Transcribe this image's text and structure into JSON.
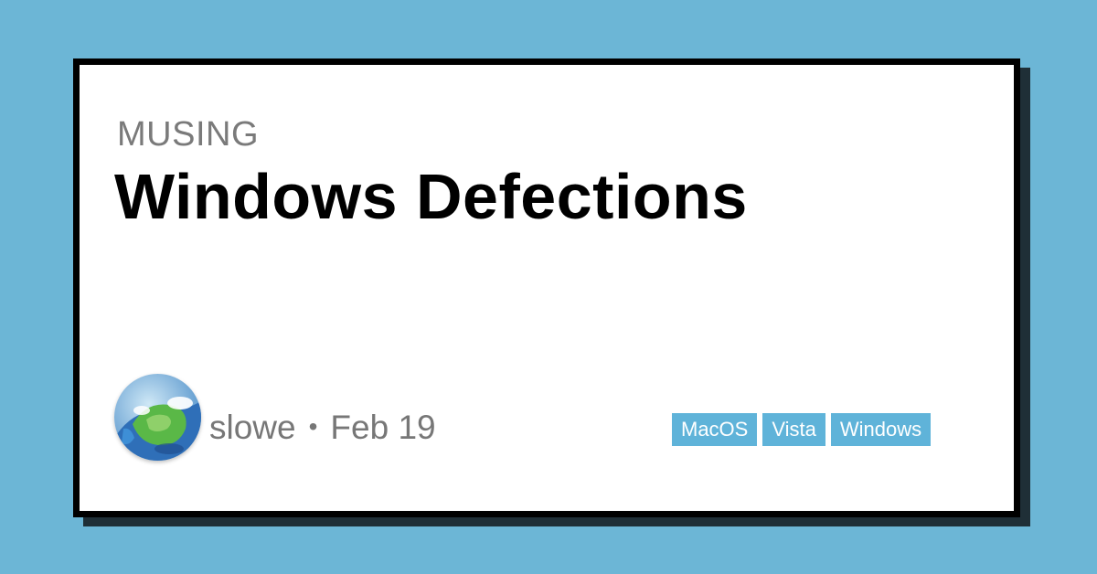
{
  "post": {
    "category": "MUSING",
    "title": "Windows Defections",
    "author": "slowe",
    "separator": "•",
    "date": "Feb 19",
    "tags": [
      "MacOS",
      "Vista",
      "Windows"
    ]
  },
  "colors": {
    "background": "#6cb6d6",
    "card": "#ffffff",
    "border": "#000000",
    "tag": "#5fb3d9",
    "muted_text": "#777777"
  },
  "icons": {
    "avatar": "earth-globe-avatar"
  }
}
